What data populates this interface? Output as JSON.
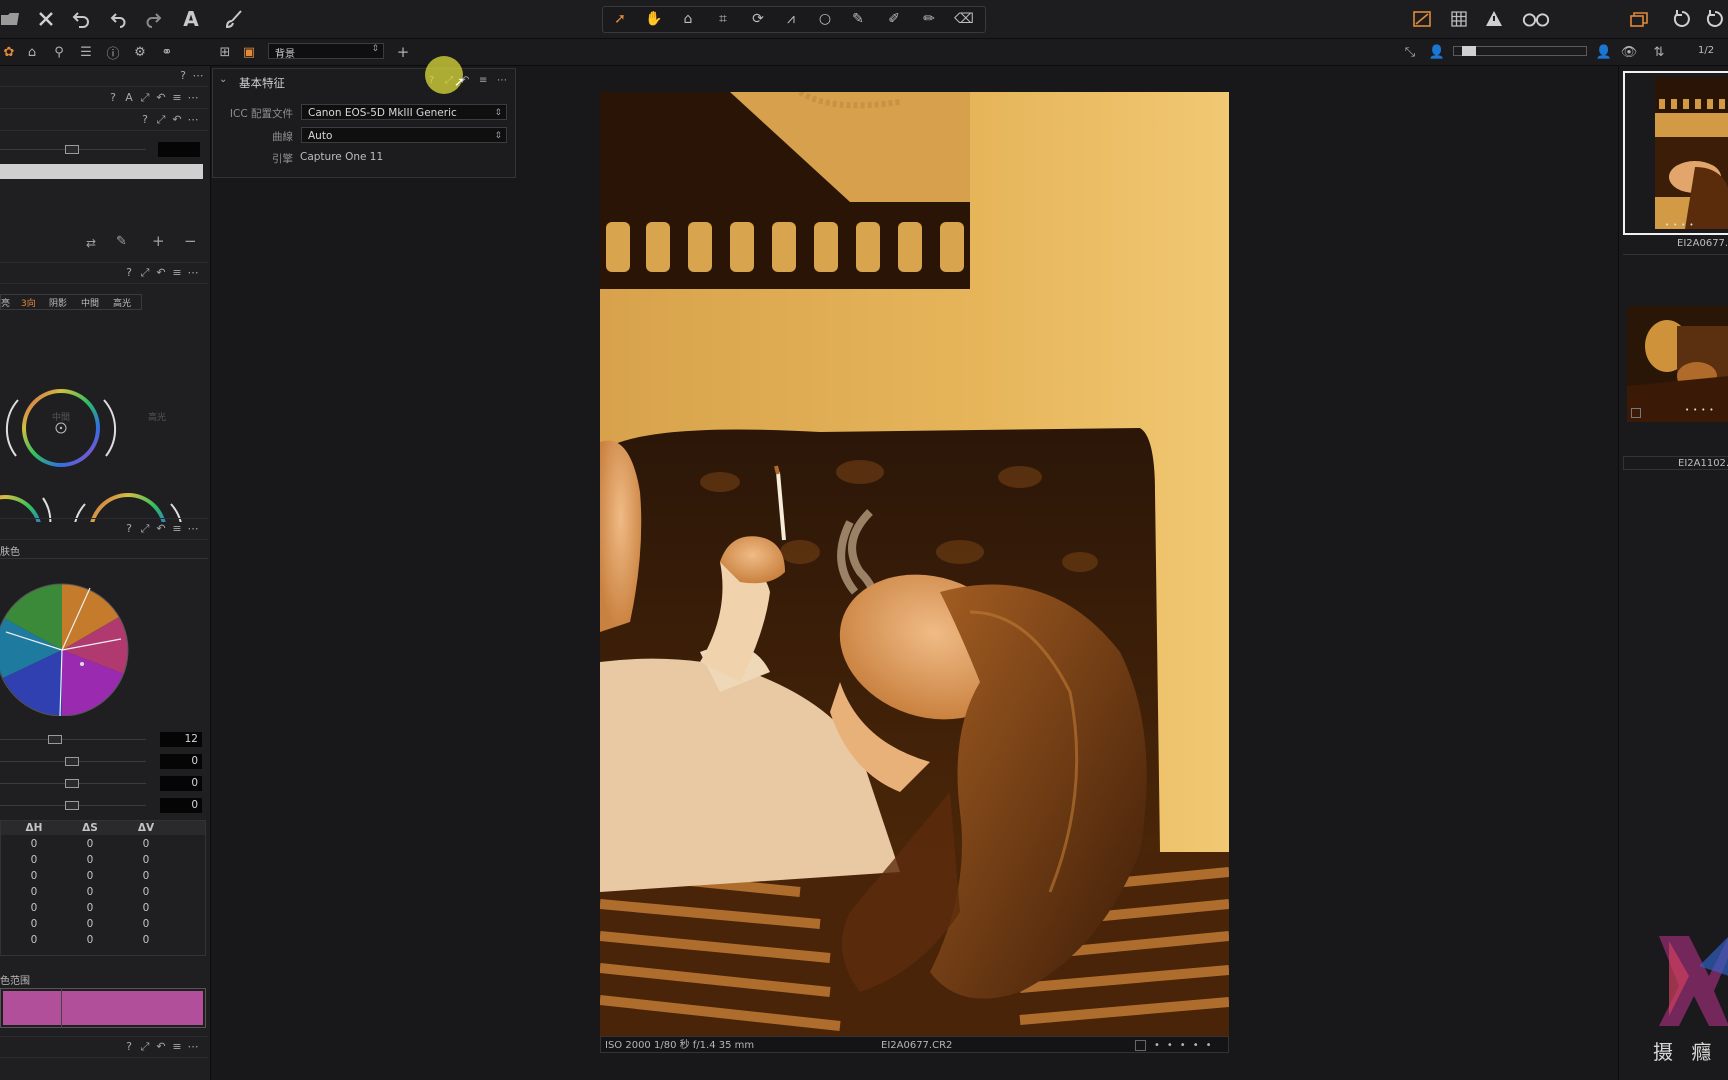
{
  "toolbar": {
    "tools_left": [
      "folder-icon",
      "close-icon",
      "undo-icon",
      "undo-step-icon",
      "redo-icon",
      "text-tool-icon",
      "brush-icon"
    ],
    "tools_center": [
      "select-arrow-icon",
      "pan-hand-icon",
      "loupe-icon",
      "crop-icon",
      "rotate-icon",
      "keystone-icon",
      "spot-circle-icon",
      "draw-mask-icon",
      "erase-mask-icon",
      "gradient-mask-icon",
      "eraser-icon"
    ],
    "tools_right": [
      "exposure-warning-icon",
      "grid-icon",
      "warning-triangle-icon",
      "proof-glasses-icon",
      "window-stack-icon",
      "reset-icon",
      "refresh-icon"
    ]
  },
  "bar2": {
    "tab_icons": [
      "color-tab-icon",
      "lens-tab-icon",
      "search-tab-icon",
      "list-tab-icon",
      "info-tab-icon",
      "settings-tab-icon",
      "adjustments-tab-icon"
    ],
    "preset_value": "背景",
    "counter": "1/2"
  },
  "left_panel": {
    "color_balance_tabs": [
      "亮",
      "3向",
      "阴影",
      "中間",
      "高光"
    ],
    "wheel_label_mid": "中間",
    "wheel_label_high": "高光",
    "skin_tone_label": "肤色",
    "sliders": [
      "12",
      "0",
      "0",
      "0"
    ],
    "table_headers": [
      "ΔH",
      "ΔS",
      "ΔV"
    ],
    "table_rows": [
      [
        "0",
        "0",
        "0"
      ],
      [
        "0",
        "0",
        "0"
      ],
      [
        "0",
        "0",
        "0"
      ],
      [
        "0",
        "0",
        "0"
      ],
      [
        "0",
        "0",
        "0"
      ],
      [
        "0",
        "0",
        "0"
      ],
      [
        "0",
        "0",
        "0"
      ]
    ],
    "range_label": "色范围",
    "colors": {
      "range_bar": "#b14f9a"
    }
  },
  "feature_panel": {
    "title": "基本特征",
    "icc_label": "ICC 配置文件",
    "icc_value": "Canon EOS-5D MkIII Generic",
    "curve_label": "曲線",
    "curve_value": "Auto",
    "engine_label": "引擎",
    "engine_value": "Capture One 11"
  },
  "photo": {
    "exif": "ISO 2000  1/80 秒  f/1.4  35 mm",
    "filename": "EI2A0677.CR2"
  },
  "right_panel": {
    "thumbnails": [
      {
        "label": "EI2A0677.",
        "selected": true
      },
      {
        "label": "EI2A1102.",
        "selected": false
      }
    ],
    "watermark_text": "摄 癮 ﾞ"
  }
}
